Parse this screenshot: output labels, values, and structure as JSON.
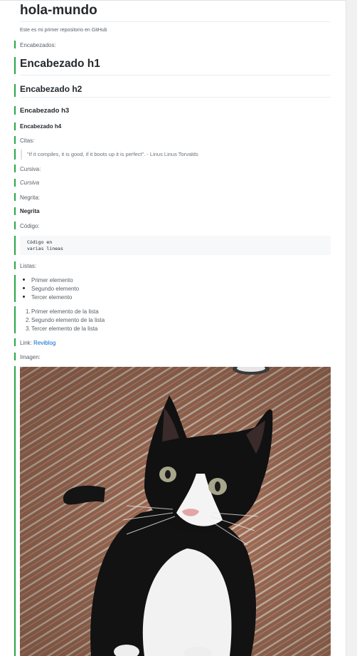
{
  "repo": {
    "title": "hola-mundo",
    "description": "Este es mi primer repositorio en GitHub"
  },
  "sections": {
    "headings_label": "Encabezados:",
    "h1": "Encabezado h1",
    "h2": "Encabezado h2",
    "h3": "Encabezado h3",
    "h4": "Encabezado h4",
    "quotes_label": "Citas:",
    "quote": "\"If it compiles, it is good, if it boots up it is perfect\". - Linus Linus Torvalds",
    "italic_label": "Cursiva:",
    "italic_text": "Cursiva",
    "bold_label": "Negrita:",
    "bold_text": "Negrita",
    "code_label": "Código:",
    "code_lines": [
      "Código en",
      "varias lineas"
    ],
    "lists_label": "Listas:",
    "unordered": [
      "Primer elemento",
      "Segundo elemento",
      "Tercer elemento"
    ],
    "ordered": [
      "Primer elemento de la lista",
      "Segundo elemento de la lista",
      "Tercer elemento de la lista"
    ],
    "link_label": "Link:",
    "link_text": "Reviblog",
    "image_label": "Imagen:"
  },
  "colors": {
    "accent_bar": "#28a745",
    "link": "#0366d6"
  },
  "icons": [
    "cat-photo"
  ]
}
